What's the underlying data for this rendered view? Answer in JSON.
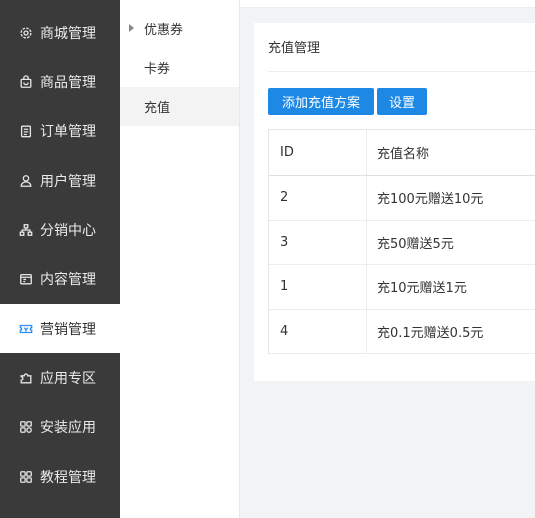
{
  "sidebar": {
    "items": [
      {
        "label": "商城管理",
        "icon": "gear-icon"
      },
      {
        "label": "商品管理",
        "icon": "bag-icon"
      },
      {
        "label": "订单管理",
        "icon": "clipboard-icon"
      },
      {
        "label": "用户管理",
        "icon": "user-icon"
      },
      {
        "label": "分销中心",
        "icon": "network-icon"
      },
      {
        "label": "内容管理",
        "icon": "document-icon"
      },
      {
        "label": "营销管理",
        "icon": "ticket-icon"
      },
      {
        "label": "应用专区",
        "icon": "puzzle-icon"
      },
      {
        "label": "安装应用",
        "icon": "apps-icon"
      },
      {
        "label": "教程管理",
        "icon": "grid-icon"
      }
    ],
    "active_index": 6,
    "active_color": "#2d8cf0"
  },
  "submenu": {
    "items": [
      {
        "label": "优惠券"
      },
      {
        "label": "卡券"
      },
      {
        "label": "充值"
      }
    ],
    "active_index": 2
  },
  "main": {
    "card_title": "充值管理",
    "buttons": {
      "add_label": "添加充值方案",
      "settings_label": "设置",
      "color": "#1e88e5"
    },
    "table": {
      "headers": {
        "id": "ID",
        "name": "充值名称"
      },
      "rows": [
        {
          "id": "2",
          "name": "充100元赠送10元"
        },
        {
          "id": "3",
          "name": "充50赠送5元"
        },
        {
          "id": "1",
          "name": "充10元赠送1元"
        },
        {
          "id": "4",
          "name": "充0.1元赠送0.5元"
        }
      ]
    }
  }
}
